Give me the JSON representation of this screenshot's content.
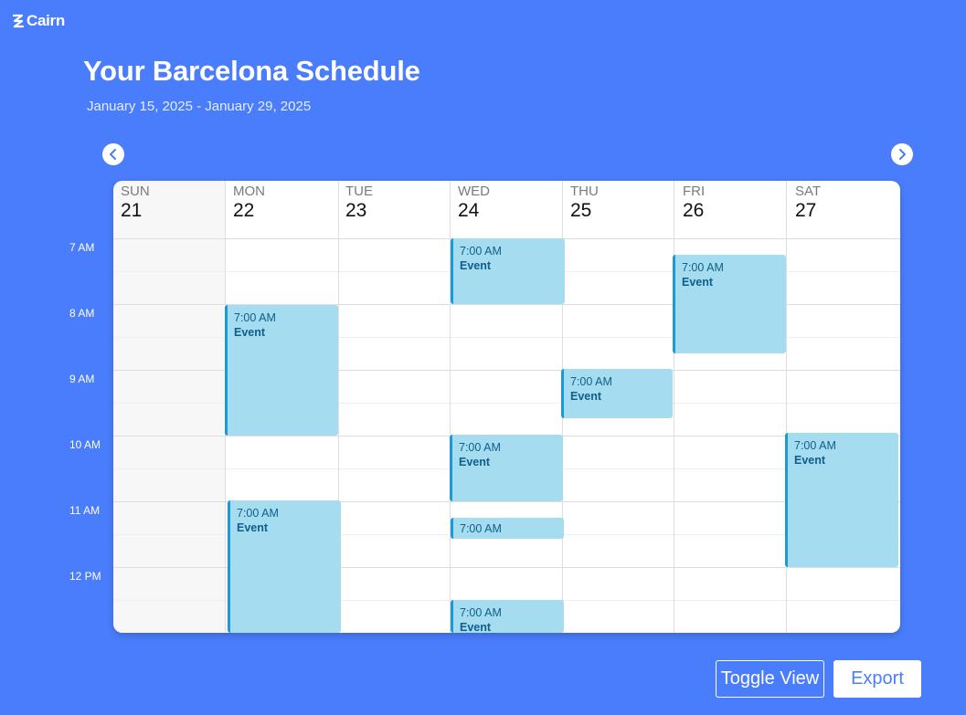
{
  "app": {
    "name": "Cairn"
  },
  "header": {
    "title": "Your Barcelona Schedule",
    "date_range": "January 15, 2025 - January 29, 2025"
  },
  "nav": {
    "prev_icon": "chevron-left-icon",
    "next_icon": "chevron-right-icon"
  },
  "time_labels": [
    "7 AM",
    "8 AM",
    "9 AM",
    "10 AM",
    "11 AM",
    "12 PM"
  ],
  "days": [
    {
      "name": "SUN",
      "date": "21"
    },
    {
      "name": "MON",
      "date": "22"
    },
    {
      "name": "TUE",
      "date": "23"
    },
    {
      "name": "WED",
      "date": "24"
    },
    {
      "name": "THU",
      "date": "25"
    },
    {
      "name": "FRI",
      "date": "26"
    },
    {
      "name": "SAT",
      "date": "27"
    }
  ],
  "events": [
    {
      "time": "7:00 AM",
      "title": "Event"
    },
    {
      "time": "7:00 AM",
      "title": "Event"
    },
    {
      "time": "7:00 AM",
      "title": "Event"
    },
    {
      "time": "7:00 AM",
      "title": "Event"
    },
    {
      "time": "7:00 AM",
      "title": "Event"
    },
    {
      "time": "7:00 AM",
      "title": "Event"
    },
    {
      "time": "7:00 AM",
      "title": "Event"
    },
    {
      "time": "7:00 AM",
      "title": ""
    },
    {
      "time": "7:00 AM",
      "title": "Event"
    }
  ],
  "actions": {
    "toggle_label": "Toggle View",
    "export_label": "Export"
  },
  "colors": {
    "background": "#4a7dfc",
    "event_fill": "#a6dcf0",
    "event_border": "#1b9ad6",
    "event_text": "#0d5f8c"
  }
}
